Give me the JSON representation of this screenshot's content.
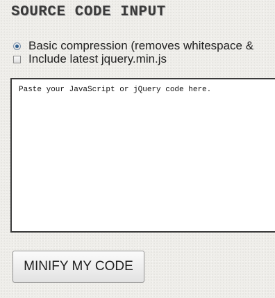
{
  "heading": "SOURCE CODE INPUT",
  "options": {
    "basic_compression": {
      "label": "Basic compression (removes whitespace &",
      "checked": true
    },
    "include_jquery": {
      "label": "Include latest jquery.min.js",
      "checked": false
    }
  },
  "code_input": {
    "placeholder": "Paste your JavaScript or jQuery code here.",
    "value": ""
  },
  "minify_button": {
    "label": "MINIFY MY CODE"
  }
}
